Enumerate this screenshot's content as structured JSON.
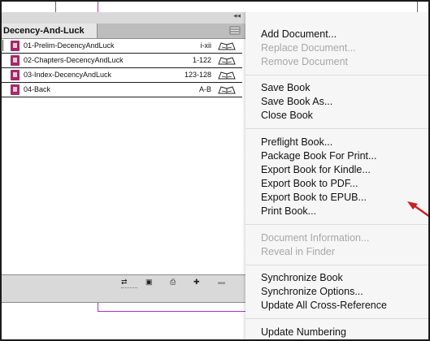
{
  "panel": {
    "tab_label": "Decency-And-Luck",
    "documents": [
      {
        "name": "01-Prelim-DecencyAndLuck",
        "pages": "i-xii"
      },
      {
        "name": "02-Chapters-DecencyAndLuck",
        "pages": "1-122"
      },
      {
        "name": "03-Index-DecencyAndLuck",
        "pages": "123-128"
      },
      {
        "name": "04-Back",
        "pages": "A-B"
      }
    ]
  },
  "menu": {
    "items": [
      {
        "label": "Add Document...",
        "enabled": true
      },
      {
        "label": "Replace Document...",
        "enabled": false
      },
      {
        "label": "Remove Document",
        "enabled": false
      },
      {
        "label": "Save Book",
        "enabled": true
      },
      {
        "label": "Save Book As...",
        "enabled": true
      },
      {
        "label": "Close Book",
        "enabled": true
      },
      {
        "label": "Preflight Book...",
        "enabled": true
      },
      {
        "label": "Package Book For Print...",
        "enabled": true
      },
      {
        "label": "Export Book for Kindle...",
        "enabled": true
      },
      {
        "label": "Export Book to PDF...",
        "enabled": true
      },
      {
        "label": "Export Book to EPUB...",
        "enabled": true
      },
      {
        "label": "Print Book...",
        "enabled": true
      },
      {
        "label": "Document Information...",
        "enabled": false
      },
      {
        "label": "Reveal in Finder",
        "enabled": false
      },
      {
        "label": "Synchronize Book",
        "enabled": true
      },
      {
        "label": "Synchronize Options...",
        "enabled": true
      },
      {
        "label": "Update All Cross-Reference",
        "enabled": true
      },
      {
        "label": "Update Numbering",
        "enabled": true
      }
    ]
  },
  "colors": {
    "guide": "#b02bd6",
    "doc_icon": "#a52a66",
    "arrow": "#cc1f1f"
  },
  "icons": [
    "collapse-icon",
    "panel-menu-icon",
    "document-icon",
    "book-icon",
    "sync-source-icon",
    "synchronize-icon",
    "save-icon",
    "print-icon",
    "add-document-icon",
    "remove-document-icon",
    "red-arrow-icon"
  ]
}
